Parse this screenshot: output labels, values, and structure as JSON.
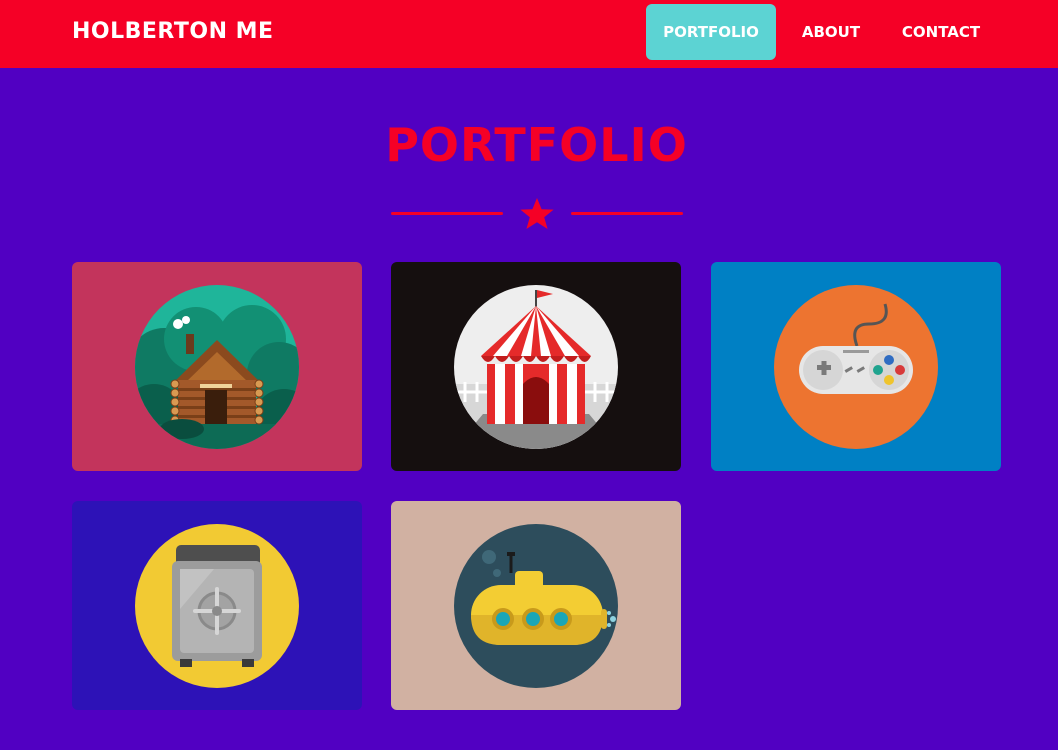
{
  "navbar": {
    "brand": "HOLBERTON ME",
    "links": [
      {
        "label": "PORTFOLIO",
        "active": true
      },
      {
        "label": "ABOUT",
        "active": false
      },
      {
        "label": "CONTACT",
        "active": false
      }
    ]
  },
  "section": {
    "title": "PORTFOLIO",
    "divider_icon": "star-icon"
  },
  "portfolio": {
    "items": [
      {
        "icon": "log-cabin-icon",
        "background": "#c3345c"
      },
      {
        "icon": "circus-tent-icon",
        "background": "#150f0f"
      },
      {
        "icon": "game-controller-icon",
        "background": "#0080c4"
      },
      {
        "icon": "safe-icon",
        "background": "#2d12b7"
      },
      {
        "icon": "submarine-icon",
        "background": "#d1b1a2"
      }
    ]
  },
  "colors": {
    "page_background": "#5100c2",
    "navbar_background": "#f50026",
    "active_link": "#5cd3d3",
    "accent": "#f50026"
  }
}
